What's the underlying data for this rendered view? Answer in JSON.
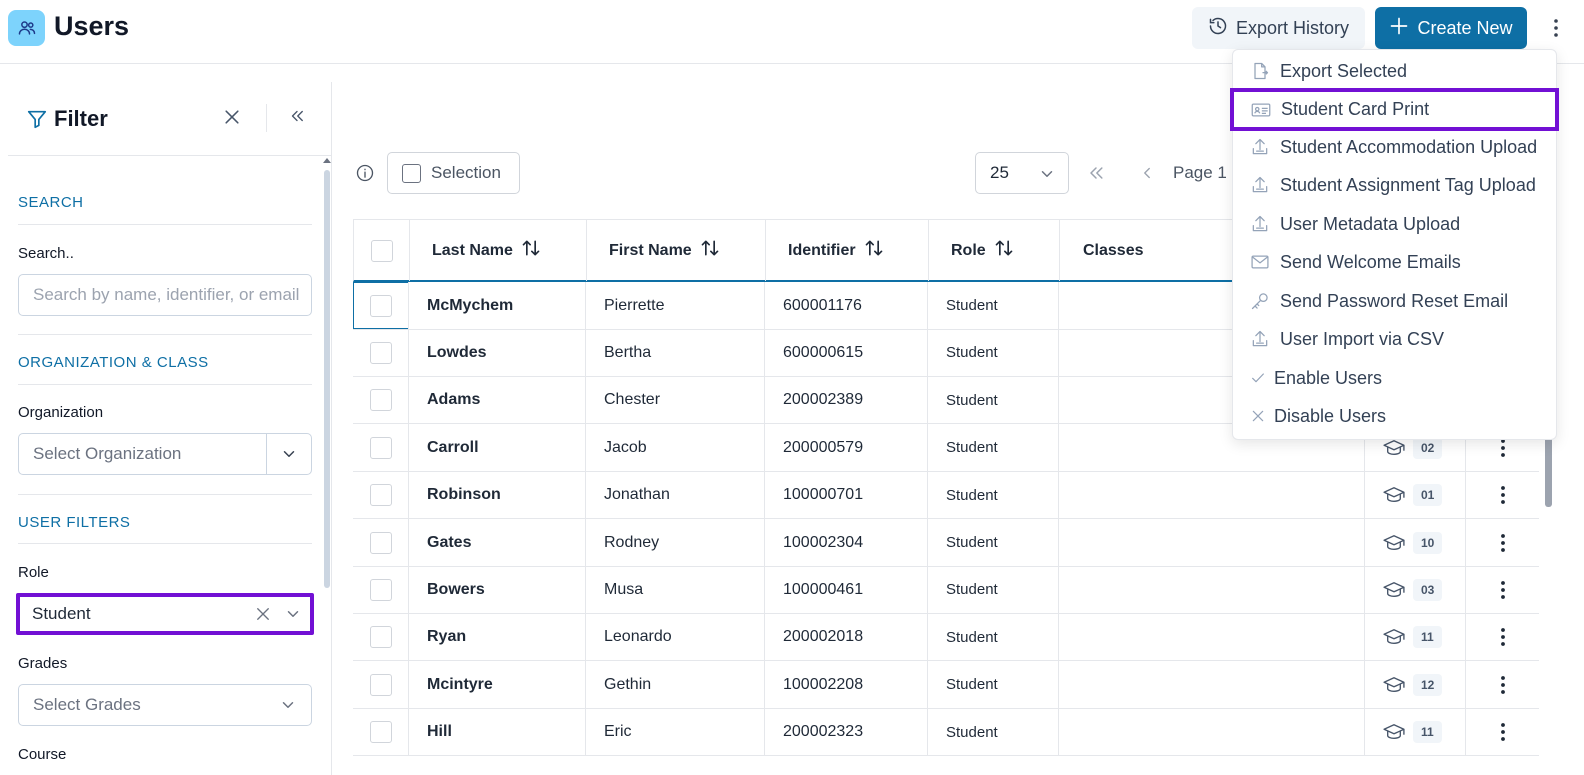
{
  "header": {
    "title": "Users",
    "export_history_label": "Export History",
    "create_new_label": "Create New"
  },
  "menu": {
    "items": [
      {
        "label": "Export Selected",
        "icon": "file-export-icon"
      },
      {
        "label": "Student Card Print",
        "icon": "id-card-icon",
        "highlighted": true
      },
      {
        "label": "Student Accommodation Upload",
        "icon": "upload-icon"
      },
      {
        "label": "Student Assignment Tag Upload",
        "icon": "upload-icon"
      },
      {
        "label": "User Metadata Upload",
        "icon": "upload-icon"
      },
      {
        "label": "Send Welcome Emails",
        "icon": "mail-icon"
      },
      {
        "label": "Send Password Reset Email",
        "icon": "key-icon"
      },
      {
        "label": "User Import via CSV",
        "icon": "upload-icon"
      },
      {
        "label": "Enable Users",
        "icon": "check-icon"
      },
      {
        "label": "Disable Users",
        "icon": "x-icon"
      }
    ]
  },
  "filter": {
    "title": "Filter",
    "search_section": "SEARCH",
    "search_label": "Search..",
    "search_placeholder": "Search by name, identifier, or email",
    "org_section": "ORGANIZATION & CLASS",
    "org_label": "Organization",
    "org_placeholder": "Select Organization",
    "user_section": "USER FILTERS",
    "role_label": "Role",
    "role_value": "Student",
    "grades_label": "Grades",
    "grades_placeholder": "Select Grades",
    "course_label": "Course"
  },
  "toolbar": {
    "selection_label": "Selection",
    "page_size": "25",
    "page_text": "Page 1"
  },
  "table": {
    "columns": [
      "Last Name",
      "First Name",
      "Identifier",
      "Role",
      "Classes"
    ],
    "rows": [
      {
        "last": "McMychem",
        "first": "Pierrette",
        "id": "600001176",
        "role": "Student",
        "grade": ""
      },
      {
        "last": "Lowdes",
        "first": "Bertha",
        "id": "600000615",
        "role": "Student",
        "grade": ""
      },
      {
        "last": "Adams",
        "first": "Chester",
        "id": "200002389",
        "role": "Student",
        "grade": ""
      },
      {
        "last": "Carroll",
        "first": "Jacob",
        "id": "200000579",
        "role": "Student",
        "grade": "02"
      },
      {
        "last": "Robinson",
        "first": "Jonathan",
        "id": "100000701",
        "role": "Student",
        "grade": "01"
      },
      {
        "last": "Gates",
        "first": "Rodney",
        "id": "100002304",
        "role": "Student",
        "grade": "10"
      },
      {
        "last": "Bowers",
        "first": "Musa",
        "id": "100000461",
        "role": "Student",
        "grade": "03"
      },
      {
        "last": "Ryan",
        "first": "Leonardo",
        "id": "200002018",
        "role": "Student",
        "grade": "11"
      },
      {
        "last": "Mcintyre",
        "first": "Gethin",
        "id": "100002208",
        "role": "Student",
        "grade": "12"
      },
      {
        "last": "Hill",
        "first": "Eric",
        "id": "200002323",
        "role": "Student",
        "grade": "11"
      }
    ]
  },
  "colors": {
    "accent": "#0e6fa5",
    "highlight": "#7210d4",
    "app_icon_bg": "#7dd3fc"
  }
}
